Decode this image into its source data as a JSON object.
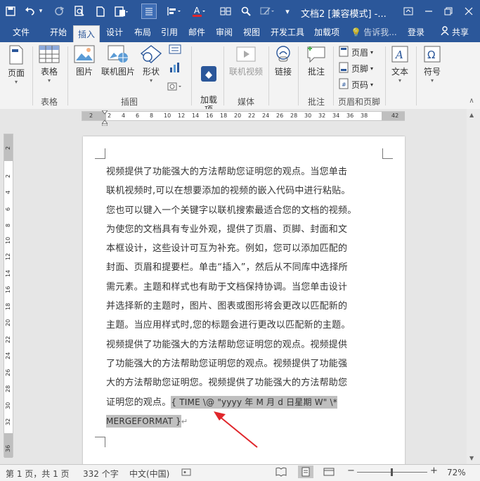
{
  "titlebar": {
    "title": "文档2 [兼容模式] -...",
    "quick_access": [
      "save-icon",
      "undo-icon",
      "undo-dropdown-icon",
      "redo-icon",
      "print-preview-icon",
      "new-doc-icon",
      "paste-icon",
      "align-icon",
      "format-icon",
      "font-color-icon",
      "table-icon",
      "find-icon",
      "draw-icon",
      "more-icon"
    ]
  },
  "tabs": {
    "file": "文件",
    "home": "开始",
    "insert": "插入",
    "design": "设计",
    "layout": "布局",
    "references": "引用",
    "mailings": "邮件",
    "review": "审阅",
    "view": "视图",
    "developer": "开发工具",
    "addins": "加载项",
    "tell_me": "告诉我...",
    "signin": "登录",
    "share": "共享"
  },
  "ribbon": {
    "page": "页面",
    "table": "表格",
    "picture": "图片",
    "online_picture": "联机图片",
    "shapes": "形状",
    "addins": "加载\n项",
    "online_video": "联机视频",
    "link": "链接",
    "comment": "批注",
    "header": "页眉",
    "footer": "页脚",
    "page_number": "页码",
    "textbox": "文本",
    "symbol": "符号",
    "groups": {
      "table": "表格",
      "illustrations": "插图",
      "media": "媒体",
      "comments": "批注",
      "header_footer": "页眉和页脚"
    }
  },
  "ruler": {
    "h_numbers": [
      "2",
      "2",
      "4",
      "6",
      "8",
      "10",
      "12",
      "14",
      "16",
      "18",
      "20",
      "22",
      "24",
      "26",
      "28",
      "30",
      "32",
      "34",
      "36",
      "38",
      "42"
    ],
    "v_numbers": [
      "2",
      "2",
      "4",
      "6",
      "8",
      "10",
      "12",
      "14",
      "16",
      "18",
      "20",
      "22",
      "24",
      "26",
      "28",
      "30",
      "32",
      "36"
    ]
  },
  "document": {
    "lines": [
      "视频提供了功能强大的方法帮助您证明您的观点。当您单击",
      "联机视频时,可以在想要添加的视频的嵌入代码中进行粘贴。",
      "您也可以键入一个关键字以联机搜索最适合您的文档的视频。",
      "为使您的文档具有专业外观，提供了页眉、页脚、封面和文",
      "本框设计，这些设计可互为补充。例如，您可以添加匹配的",
      "封面、页眉和提要栏。单击“插入”，然后从不同库中选择所",
      "需元素。主题和样式也有助于文档保持协调。当您单击设计",
      "并选择新的主题时，图片、图表或图形将会更改以匹配新的",
      "主题。当应用样式时,您的标题会进行更改以匹配新的主题。",
      "视频提供了功能强大的方法帮助您证明您的观点。视频提供",
      "了功能强大的方法帮助您证明您的观点。视频提供了功能强",
      "大的方法帮助您证明您。视频提供了功能强大的方法帮助您"
    ],
    "last_line_prefix": "证明您的观点。",
    "field_code_line1": "{ TIME  \\@ \"yyyy 年 M 月 d 日星期 W\"  \\* ",
    "field_code_line2": "MERGEFORMAT }",
    "annotation_color": "#e0262b"
  },
  "status": {
    "page": "第 1 页，共 1 页",
    "words": "332 个字",
    "language": "中文(中国)",
    "zoom": "72%"
  },
  "colors": {
    "brand": "#2b579a",
    "ribbon": "#f3f3f3",
    "field_shading": "#bfbfbf"
  }
}
